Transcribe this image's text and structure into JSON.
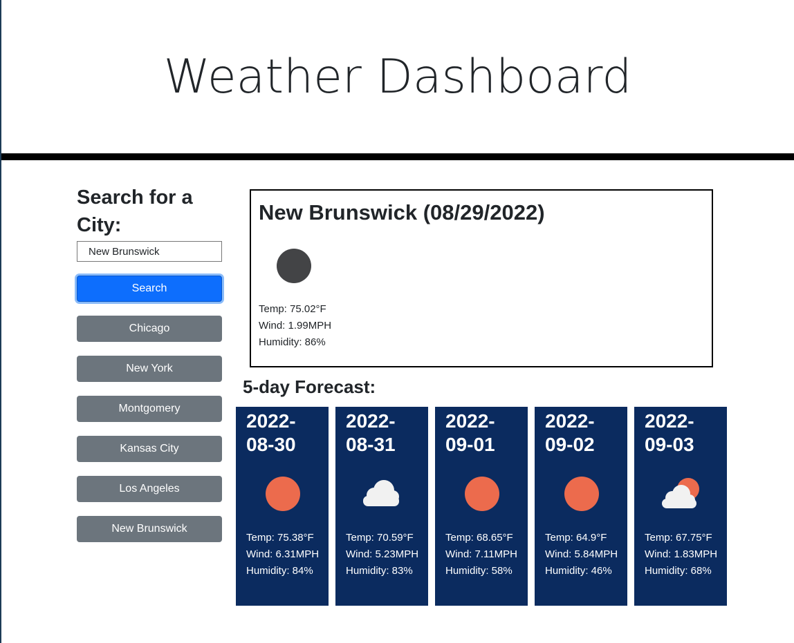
{
  "header": {
    "title": "Weather Dashboard"
  },
  "sidebar": {
    "heading": "Search for a City:",
    "search_value": "New Brunswick",
    "search_button": "Search",
    "history": [
      "Chicago",
      "New York",
      "Montgomery",
      "Kansas City",
      "Los Angeles",
      "New Brunswick"
    ]
  },
  "current": {
    "title": "New Brunswick (08/29/2022)",
    "icon": "moon-icon",
    "temp": "Temp: 75.02°F",
    "wind": "Wind: 1.99MPH",
    "humidity": "Humidity: 86%"
  },
  "forecast": {
    "heading": "5-day Forecast:",
    "days": [
      {
        "date": "2022-08-30",
        "icon": "sun-icon",
        "temp": "Temp: 75.38°F",
        "wind": "Wind: 6.31MPH",
        "humidity": "Humidity: 84%"
      },
      {
        "date": "2022-08-31",
        "icon": "cloud-icon",
        "temp": "Temp: 70.59°F",
        "wind": "Wind: 5.23MPH",
        "humidity": "Humidity: 83%"
      },
      {
        "date": "2022-09-01",
        "icon": "sun-icon",
        "temp": "Temp: 68.65°F",
        "wind": "Wind: 7.11MPH",
        "humidity": "Humidity: 58%"
      },
      {
        "date": "2022-09-02",
        "icon": "sun-icon",
        "temp": "Temp: 64.9°F",
        "wind": "Wind: 5.84MPH",
        "humidity": "Humidity: 46%"
      },
      {
        "date": "2022-09-03",
        "icon": "partly-cloudy-icon",
        "temp": "Temp: 67.75°F",
        "wind": "Wind: 1.83MPH",
        "humidity": "Humidity: 68%"
      }
    ]
  },
  "colors": {
    "primary": "#0d6efd",
    "secondary": "#6c757d",
    "forecast_card": "#0b2b5f",
    "sun": "#ec6b4d",
    "cloud": "#f1f1f1",
    "moon": "#434446"
  }
}
